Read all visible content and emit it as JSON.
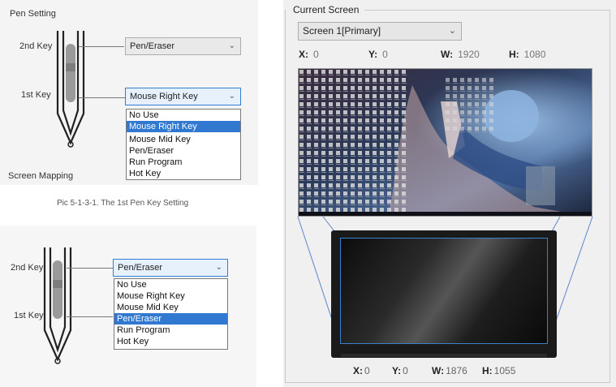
{
  "colors": {
    "accent": "#3078d0",
    "mapping_lines": "#5b86c8"
  },
  "pen_setting_1": {
    "section_title": "Pen Setting",
    "key2_label": "2nd Key",
    "key1_label": "1st Key",
    "key2_value": "Pen/Eraser",
    "key1_value": "Mouse Right Key",
    "options": [
      "No Use",
      "Mouse Right Key",
      "Mouse Mid Key",
      "Pen/Eraser",
      "Run Program",
      "Hot Key"
    ],
    "selected_option": "Mouse Right Key",
    "next_section": "Screen Mapping",
    "caption": "Pic 5-1-3-1. The 1st Pen Key Setting"
  },
  "pen_setting_2": {
    "key2_label": "2nd Key",
    "key1_label": "1st Key",
    "key2_value": "Pen/Eraser",
    "options": [
      "No Use",
      "Mouse Right Key",
      "Mouse Mid Key",
      "Pen/Eraser",
      "Run Program",
      "Hot Key"
    ],
    "selected_option": "Pen/Eraser"
  },
  "current_screen": {
    "title": "Current Screen",
    "screen_select": "Screen 1[Primary]",
    "monitor": {
      "x_label": "X:",
      "x": "0",
      "y_label": "Y:",
      "y": "0",
      "w_label": "W:",
      "w": "1920",
      "h_label": "H:",
      "h": "1080"
    },
    "tablet": {
      "x_label": "X:",
      "x": "0",
      "y_label": "Y:",
      "y": "0",
      "w_label": "W:",
      "w": "1876",
      "h_label": "H:",
      "h": "1055"
    }
  }
}
